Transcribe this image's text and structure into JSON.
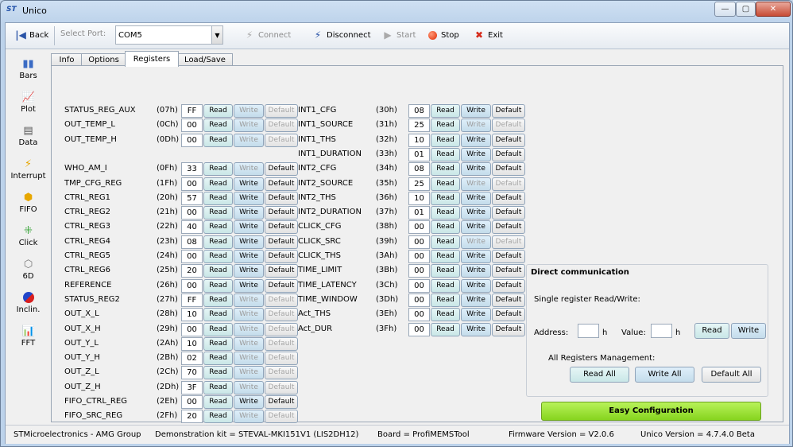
{
  "window": {
    "title": "Unico",
    "logo": "ST",
    "min_label": "—",
    "max_label": "▢",
    "close_label": "✕"
  },
  "toolbar": {
    "back": "Back",
    "select_port_label": "Select Port:",
    "port_value": "COM5",
    "connect": "Connect",
    "disconnect": "Disconnect",
    "start": "Start",
    "stop": "Stop",
    "exit": "Exit",
    "icons": {
      "back": "back-icon",
      "connect": "connect-plug-icon",
      "disconnect": "disconnect-plug-icon",
      "start": "play-icon",
      "stop": "stop-icon",
      "exit": "exit-x-icon"
    }
  },
  "sidebar": {
    "items": [
      {
        "label": "Bars",
        "icon": "bars-chart-icon"
      },
      {
        "label": "Plot",
        "icon": "plot-icon"
      },
      {
        "label": "Data",
        "icon": "data-icon"
      },
      {
        "label": "Interrupt",
        "icon": "interrupt-icon"
      },
      {
        "label": "FIFO",
        "icon": "fifo-icon"
      },
      {
        "label": "Click",
        "icon": "click-icon"
      },
      {
        "label": "6D",
        "icon": "six-d-icon"
      },
      {
        "label": "Inclin.",
        "icon": "inclination-icon"
      },
      {
        "label": "FFT",
        "icon": "fft-icon"
      }
    ]
  },
  "tabs": [
    {
      "label": "Info"
    },
    {
      "label": "Options"
    },
    {
      "label": "Registers",
      "active": true
    },
    {
      "label": "Load/Save"
    }
  ],
  "buttons": {
    "read": "Read",
    "write": "Write",
    "default": "Default"
  },
  "registers_left": [
    {
      "name": "STATUS_REG_AUX",
      "addr": "(07h)",
      "value": "FF",
      "write_enabled": false,
      "default_enabled": false
    },
    {
      "name": "OUT_TEMP_L",
      "addr": "(0Ch)",
      "value": "00",
      "write_enabled": false,
      "default_enabled": false
    },
    {
      "name": "OUT_TEMP_H",
      "addr": "(0Dh)",
      "value": "00",
      "write_enabled": false,
      "default_enabled": false
    },
    {
      "name": "WHO_AM_I",
      "addr": "(0Fh)",
      "value": "33",
      "write_enabled": false,
      "default_enabled": true
    },
    {
      "name": "TMP_CFG_REG",
      "addr": "(1Fh)",
      "value": "00",
      "write_enabled": true,
      "default_enabled": true
    },
    {
      "name": "CTRL_REG1",
      "addr": "(20h)",
      "value": "57",
      "write_enabled": true,
      "default_enabled": true
    },
    {
      "name": "CTRL_REG2",
      "addr": "(21h)",
      "value": "00",
      "write_enabled": true,
      "default_enabled": true
    },
    {
      "name": "CTRL_REG3",
      "addr": "(22h)",
      "value": "40",
      "write_enabled": true,
      "default_enabled": true
    },
    {
      "name": "CTRL_REG4",
      "addr": "(23h)",
      "value": "08",
      "write_enabled": true,
      "default_enabled": true
    },
    {
      "name": "CTRL_REG5",
      "addr": "(24h)",
      "value": "00",
      "write_enabled": true,
      "default_enabled": true
    },
    {
      "name": "CTRL_REG6",
      "addr": "(25h)",
      "value": "20",
      "write_enabled": true,
      "default_enabled": true
    },
    {
      "name": "REFERENCE",
      "addr": "(26h)",
      "value": "00",
      "write_enabled": true,
      "default_enabled": true
    },
    {
      "name": "STATUS_REG2",
      "addr": "(27h)",
      "value": "FF",
      "write_enabled": false,
      "default_enabled": false
    },
    {
      "name": "OUT_X_L",
      "addr": "(28h)",
      "value": "10",
      "write_enabled": false,
      "default_enabled": false
    },
    {
      "name": "OUT_X_H",
      "addr": "(29h)",
      "value": "00",
      "write_enabled": false,
      "default_enabled": false
    },
    {
      "name": "OUT_Y_L",
      "addr": "(2Ah)",
      "value": "10",
      "write_enabled": false,
      "default_enabled": false
    },
    {
      "name": "OUT_Y_H",
      "addr": "(2Bh)",
      "value": "02",
      "write_enabled": false,
      "default_enabled": false
    },
    {
      "name": "OUT_Z_L",
      "addr": "(2Ch)",
      "value": "70",
      "write_enabled": false,
      "default_enabled": false
    },
    {
      "name": "OUT_Z_H",
      "addr": "(2Dh)",
      "value": "3F",
      "write_enabled": false,
      "default_enabled": false
    },
    {
      "name": "FIFO_CTRL_REG",
      "addr": "(2Eh)",
      "value": "00",
      "write_enabled": true,
      "default_enabled": true
    },
    {
      "name": "FIFO_SRC_REG",
      "addr": "(2Fh)",
      "value": "20",
      "write_enabled": false,
      "default_enabled": false
    }
  ],
  "registers_right": [
    {
      "name": "INT1_CFG",
      "addr": "(30h)",
      "value": "08",
      "write_enabled": true,
      "default_enabled": true
    },
    {
      "name": "INT1_SOURCE",
      "addr": "(31h)",
      "value": "25",
      "write_enabled": false,
      "default_enabled": false
    },
    {
      "name": "INT1_THS",
      "addr": "(32h)",
      "value": "10",
      "write_enabled": true,
      "default_enabled": true
    },
    {
      "name": "INT1_DURATION",
      "addr": "(33h)",
      "value": "01",
      "write_enabled": true,
      "default_enabled": true
    },
    {
      "name": "INT2_CFG",
      "addr": "(34h)",
      "value": "08",
      "write_enabled": true,
      "default_enabled": true
    },
    {
      "name": "INT2_SOURCE",
      "addr": "(35h)",
      "value": "25",
      "write_enabled": false,
      "default_enabled": false
    },
    {
      "name": "INT2_THS",
      "addr": "(36h)",
      "value": "10",
      "write_enabled": true,
      "default_enabled": true
    },
    {
      "name": "INT2_DURATION",
      "addr": "(37h)",
      "value": "01",
      "write_enabled": true,
      "default_enabled": true
    },
    {
      "name": "CLICK_CFG",
      "addr": "(38h)",
      "value": "00",
      "write_enabled": true,
      "default_enabled": true
    },
    {
      "name": "CLICK_SRC",
      "addr": "(39h)",
      "value": "00",
      "write_enabled": false,
      "default_enabled": false
    },
    {
      "name": "CLICK_THS",
      "addr": "(3Ah)",
      "value": "00",
      "write_enabled": true,
      "default_enabled": true
    },
    {
      "name": "TIME_LIMIT",
      "addr": "(3Bh)",
      "value": "00",
      "write_enabled": true,
      "default_enabled": true
    },
    {
      "name": "TIME_LATENCY",
      "addr": "(3Ch)",
      "value": "00",
      "write_enabled": true,
      "default_enabled": true
    },
    {
      "name": "TIME_WINDOW",
      "addr": "(3Dh)",
      "value": "00",
      "write_enabled": true,
      "default_enabled": true
    },
    {
      "name": "Act_THS",
      "addr": "(3Eh)",
      "value": "00",
      "write_enabled": true,
      "default_enabled": true
    },
    {
      "name": "Act_DUR",
      "addr": "(3Fh)",
      "value": "00",
      "write_enabled": true,
      "default_enabled": true
    }
  ],
  "direct_comm": {
    "title": "Direct communication",
    "single_label": "Single register Read/Write:",
    "address_label": "Address:",
    "address_value": "",
    "value_label": "Value:",
    "value_value": "",
    "h_suffix": "h",
    "read": "Read",
    "write": "Write",
    "all_label": "All Registers Management:",
    "read_all": "Read All",
    "write_all": "Write All",
    "default_all": "Default All"
  },
  "easy_config": "Easy Configuration",
  "status_bar": {
    "company": "STMicroelectronics - AMG Group",
    "kit": "Demonstration kit = STEVAL-MKI151V1 (LIS2DH12)",
    "board": "Board = ProfiMEMSTool",
    "firmware": "Firmware Version = V2.0.6",
    "unico": "Unico Version = 4.7.4.0 Beta"
  }
}
